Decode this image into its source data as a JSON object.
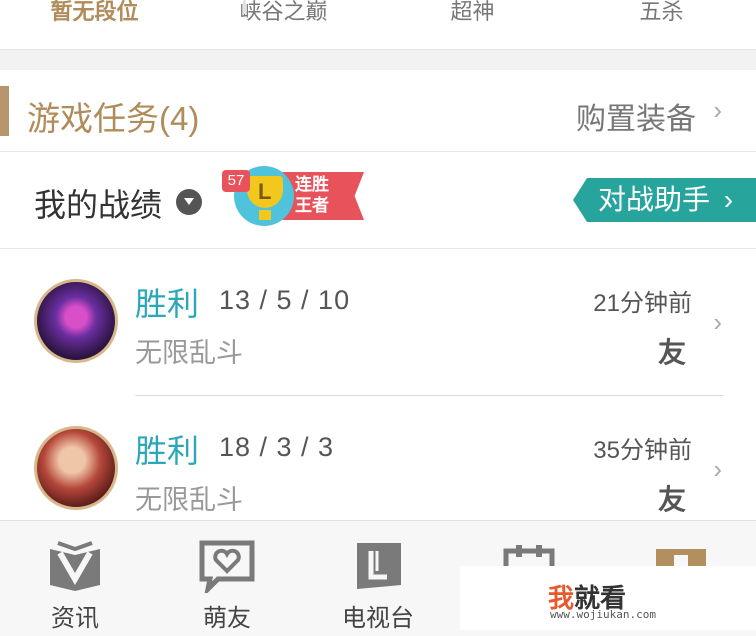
{
  "stats": {
    "rank": "暂无段位",
    "items": [
      "峡谷之巅",
      "超神",
      "五杀"
    ]
  },
  "tasks": {
    "title": "游戏任务(4)",
    "buy_label": "购置装备"
  },
  "records": {
    "title": "我的战绩",
    "badge": {
      "count": "57",
      "letter": "L",
      "line1": "连胜",
      "line2": "王者"
    },
    "assist_label": "对战助手"
  },
  "matches": [
    {
      "result": "胜利",
      "kda": "13 / 5 / 10",
      "mode": "无限乱斗",
      "time": "21分钟前",
      "tag": "友"
    },
    {
      "result": "胜利",
      "kda": "18 / 3 / 3",
      "mode": "无限乱斗",
      "time": "35分钟前",
      "tag": "友"
    }
  ],
  "nav": [
    {
      "label": "资讯",
      "icon": "book-v-icon"
    },
    {
      "label": "萌友",
      "icon": "heart-chat-icon"
    },
    {
      "label": "电视台",
      "icon": "tv-book-icon"
    },
    {
      "label": "",
      "icon": "calendar-icon"
    },
    {
      "label": "",
      "icon": "profile-icon"
    }
  ],
  "watermark": {
    "accent": "我",
    "rest": "就看",
    "url": "www.wojiukan.com"
  },
  "colors": {
    "gold": "#b08c5a",
    "teal": "#27a59c",
    "win": "#2aa8b8",
    "badge_red": "#e8525b"
  }
}
